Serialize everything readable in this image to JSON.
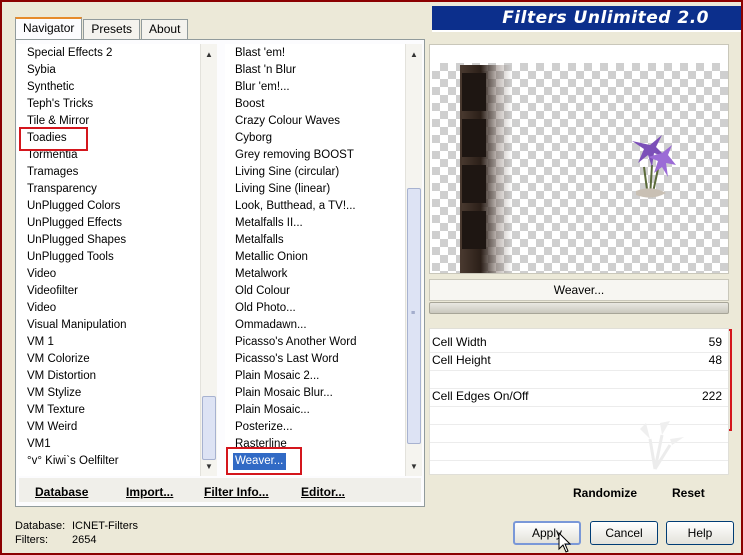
{
  "title": "Filters Unlimited 2.0",
  "tabs": [
    {
      "label": "Navigator",
      "active": true
    },
    {
      "label": "Presets",
      "active": false
    },
    {
      "label": "About",
      "active": false
    }
  ],
  "categories": [
    "Special Effects 2",
    "Sybia",
    "Synthetic",
    "Teph's Tricks",
    "Tile & Mirror",
    "Toadies",
    "Tormentia",
    "Tramages",
    "Transparency",
    "UnPlugged Colors",
    "UnPlugged Effects",
    "UnPlugged Shapes",
    "UnPlugged Tools",
    "Video",
    "Videofilter",
    "Video",
    "Visual Manipulation",
    "VM 1",
    "VM Colorize",
    "VM Distortion",
    "VM Stylize",
    "VM Texture",
    "VM Weird",
    "VM1",
    "°v° Kiwi`s Oelfilter"
  ],
  "filters": [
    "Blast 'em!",
    "Blast 'n Blur",
    "Blur 'em!...",
    "Boost",
    "Crazy Colour Waves",
    "Cyborg",
    "Grey removing BOOST",
    "Living Sine (circular)",
    "Living Sine (linear)",
    "Look, Butthead, a TV!...",
    "Metalfalls II...",
    "Metalfalls",
    "Metallic Onion",
    "Metalwork",
    "Old Colour",
    "Old Photo...",
    "Ommadawn...",
    "Picasso's Another Word",
    "Picasso's Last Word",
    "Plain Mosaic 2...",
    "Plain Mosaic Blur...",
    "Plain Mosaic...",
    "Posterize...",
    "Rasterline",
    "Weaver..."
  ],
  "selected_filter": "Weaver...",
  "selected_category": "Toadies",
  "left_buttons": {
    "database": "Database",
    "import": "Import...",
    "filter_info": "Filter Info...",
    "editor": "Editor..."
  },
  "preview": {
    "filter_name": "Weaver..."
  },
  "params": [
    {
      "label": "Cell Width",
      "value": "59"
    },
    {
      "label": "Cell Height",
      "value": "48"
    },
    {
      "label": "Cell Edges On/Off",
      "value": "222"
    }
  ],
  "right_buttons": {
    "randomize": "Randomize",
    "reset": "Reset"
  },
  "status": {
    "database_label": "Database:",
    "database_value": "ICNET-Filters",
    "filters_label": "Filters:",
    "filters_value": "2654"
  },
  "dialog_buttons": {
    "apply": "Apply",
    "cancel": "Cancel",
    "help": "Help"
  },
  "colors": {
    "highlight": "#d4161d",
    "selection": "#316ac5",
    "banner": "#0c2f8c"
  }
}
